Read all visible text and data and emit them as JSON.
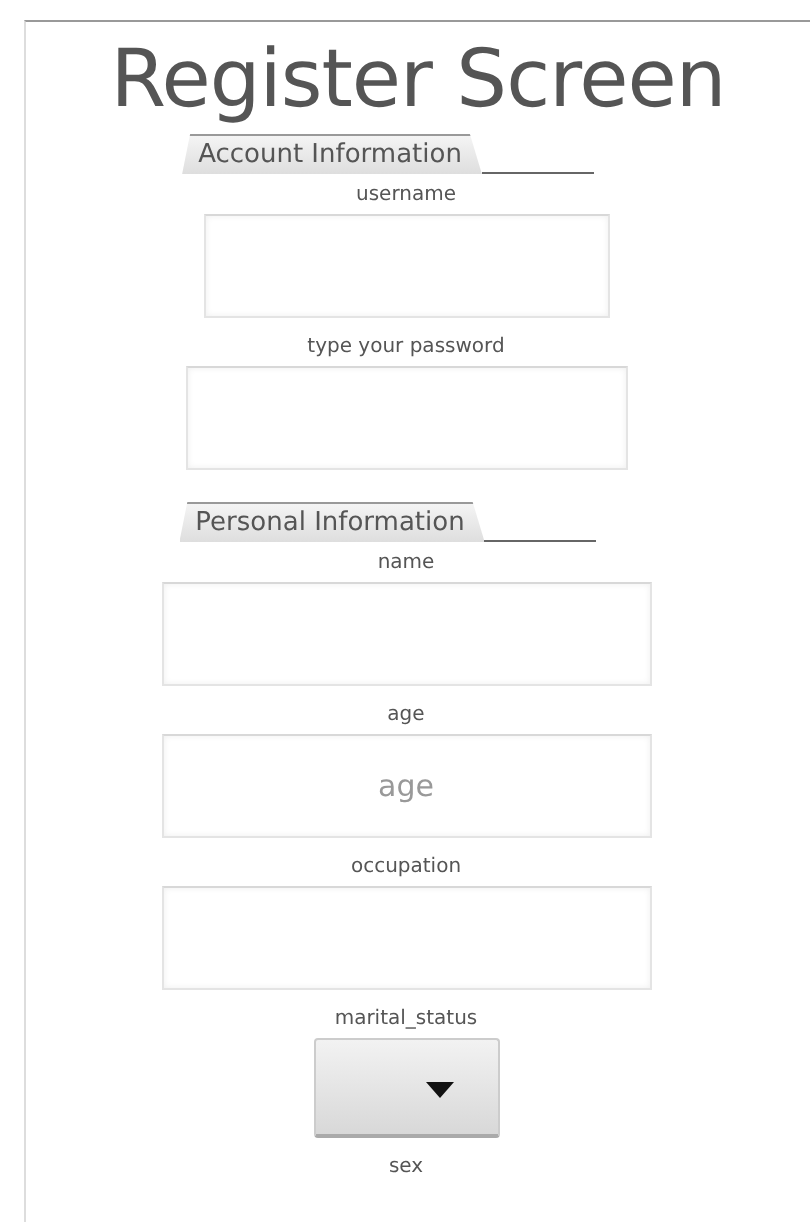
{
  "title": "Register Screen",
  "sections": [
    {
      "title": "Account Information",
      "fields": [
        {
          "label": "username",
          "kind": "text"
        },
        {
          "label": "type your password",
          "kind": "text"
        }
      ]
    },
    {
      "title": "Personal Information",
      "fields": [
        {
          "label": "name",
          "kind": "text"
        },
        {
          "label": "age",
          "kind": "text",
          "placeholder": "age"
        },
        {
          "label": "occupation",
          "kind": "text"
        },
        {
          "label": "marital_status",
          "kind": "spinner"
        },
        {
          "label": "sex",
          "kind": "offscreen"
        }
      ]
    }
  ]
}
